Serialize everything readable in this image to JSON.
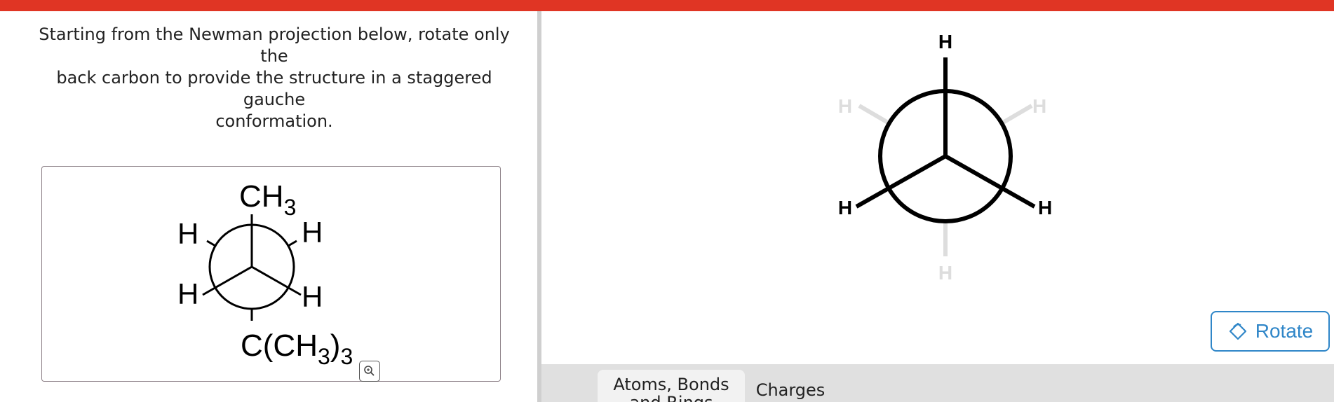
{
  "colors": {
    "top_bar": "#e03524",
    "accent": "#2f86c8",
    "faded_bond": "#dddddd",
    "bond": "#000000"
  },
  "prompt": {
    "lines": [
      "Starting from the Newman projection below, rotate only the",
      "back carbon to provide the structure in a staggered gauche",
      "conformation."
    ]
  },
  "given_structure": {
    "front_top": "CH",
    "front_top_sub": "3",
    "back_upper_left": "H",
    "back_upper_right": "H",
    "front_lower_left": "H",
    "front_lower_right": "H",
    "back_bottom_pre": "C(CH",
    "back_bottom_sub1": "3",
    "back_bottom_mid": ")",
    "back_bottom_sub2": "3",
    "zoom_icon": "magnifier-zoom-icon"
  },
  "workspace": {
    "front_top": "H",
    "front_lower_left": "H",
    "front_lower_right": "H",
    "back_upper_left": "H",
    "back_upper_right": "H",
    "back_bottom": "H"
  },
  "rotate_button": {
    "label": "Rotate",
    "icon": "rotate-icon"
  },
  "toolbar": {
    "tabs": [
      "Atoms, Bonds and Rings",
      "Charges"
    ],
    "active_tab": "Atoms, Bonds and Rings"
  }
}
